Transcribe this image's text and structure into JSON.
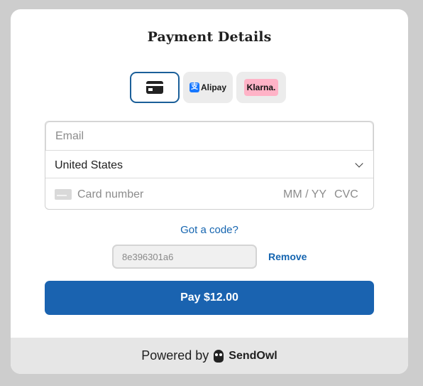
{
  "title": "Payment Details",
  "payment_methods": {
    "card": {
      "icon": "credit-card-icon"
    },
    "alipay": {
      "label": "Alipay",
      "logo_glyph": "支",
      "icon": "alipay-logo-icon",
      "color": "#1677ff"
    },
    "klarna": {
      "label": "Klarna.",
      "color": "#ffb3c7"
    }
  },
  "form": {
    "email": {
      "placeholder": "Email",
      "value": ""
    },
    "country": {
      "value": "United States"
    },
    "card": {
      "number_placeholder": "Card number",
      "expiry_placeholder": "MM / YY",
      "cvc_placeholder": "CVC"
    }
  },
  "coupon": {
    "link_label": "Got a code?",
    "code": "8e396301a6",
    "remove_label": "Remove"
  },
  "pay_button": {
    "label": "Pay $12.00"
  },
  "footer": {
    "powered_by": "Powered by",
    "brand": "SendOwl",
    "brand_icon": "sendowl-owl-icon"
  },
  "colors": {
    "accent": "#1a63b0",
    "link": "#1565b0",
    "selected_border": "#1b5f99"
  }
}
